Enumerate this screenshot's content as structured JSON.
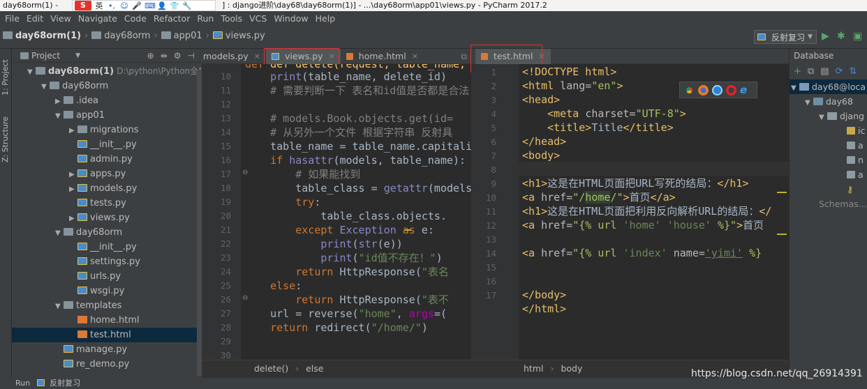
{
  "window": {
    "title_left": "day68orm(1) -",
    "title_right": "] : django进阶\\day68\\day68orm(1)] - ...\\day68orm\\app01\\views.py - PyCharm 2017.2"
  },
  "ime": {
    "logo": "S",
    "lang": "英"
  },
  "menu": [
    "File",
    "Edit",
    "View",
    "Navigate",
    "Code",
    "Refactor",
    "Run",
    "Tools",
    "VCS",
    "Window",
    "Help"
  ],
  "breadcrumb": [
    "day68orm(1)",
    "day68orm",
    "app01",
    "views.py"
  ],
  "run_config": "反射复习",
  "left_tabs": {
    "project": "1: Project",
    "structure": "Z: Structure"
  },
  "project_panel": {
    "title": "Project",
    "root": {
      "name": "day68orm(1)",
      "path": "D:\\python\\Python全栈9期"
    },
    "items": [
      {
        "label": "day68orm",
        "type": "folder",
        "depth": 1,
        "open": true
      },
      {
        "label": ".idea",
        "type": "folder",
        "depth": 2,
        "open": false
      },
      {
        "label": "app01",
        "type": "folder",
        "depth": 2,
        "open": true
      },
      {
        "label": "migrations",
        "type": "folder",
        "depth": 3,
        "open": false
      },
      {
        "label": "__init__.py",
        "type": "py",
        "depth": 3
      },
      {
        "label": "admin.py",
        "type": "py",
        "depth": 3
      },
      {
        "label": "apps.py",
        "type": "py",
        "depth": 3,
        "open": false
      },
      {
        "label": "models.py",
        "type": "py",
        "depth": 3,
        "open": false
      },
      {
        "label": "tests.py",
        "type": "py",
        "depth": 3
      },
      {
        "label": "views.py",
        "type": "py",
        "depth": 3,
        "open": false
      },
      {
        "label": "day68orm",
        "type": "folder",
        "depth": 2,
        "open": true
      },
      {
        "label": "__init__.py",
        "type": "py",
        "depth": 3
      },
      {
        "label": "settings.py",
        "type": "py",
        "depth": 3
      },
      {
        "label": "urls.py",
        "type": "py",
        "depth": 3
      },
      {
        "label": "wsgi.py",
        "type": "py",
        "depth": 3
      },
      {
        "label": "templates",
        "type": "folder",
        "depth": 2,
        "open": true
      },
      {
        "label": "home.html",
        "type": "html",
        "depth": 3
      },
      {
        "label": "test.html",
        "type": "html",
        "depth": 3,
        "selected": true
      },
      {
        "label": "manage.py",
        "type": "py",
        "depth": 2
      },
      {
        "label": "re_demo.py",
        "type": "py",
        "depth": 2
      }
    ]
  },
  "left_tabs_bar": [
    "models.py",
    "views.py",
    "home.html"
  ],
  "left_editor": {
    "line_numbers": [
      "10",
      "11",
      "12",
      "13",
      "14",
      "15",
      "16",
      "17",
      "18",
      "19",
      "20",
      "21",
      "22",
      "23",
      "24",
      "25",
      "26",
      "27",
      "28",
      "29",
      "30"
    ],
    "lines": [
      "    print(table_name, delete_id)",
      "    # 需要判断一下 表名和id值是否都是合法",
      "",
      "    # models.Book.objects.get(id=",
      "    # 从另外一个文件 根据字符串 反射具",
      "    table_name = table_name.capitalize()",
      "    if hasattr(models, table_name):",
      "        # 如果能找到",
      "        table_class = getattr(models",
      "        try:",
      "            table_class.objects.",
      "        except Exception as e:",
      "            print(str(e))",
      "            print(\"id值不存在！\")",
      "        return HttpResponse(\"表名",
      "    else:",
      "        return HttpResponse(\"表不",
      "    url = reverse(\"home\", args=(",
      "    return redirect(\"/home/\")",
      "",
      ""
    ],
    "partial_top": "def delete(request, table_name,",
    "breadcrumb": [
      "delete()",
      "else"
    ]
  },
  "right_tab": "test.html",
  "right_editor": {
    "line_numbers": [
      "1",
      "2",
      "3",
      "4",
      "5",
      "6",
      "7",
      "8",
      "9",
      "10",
      "11",
      "12",
      "13",
      "14",
      "15",
      "16",
      "17"
    ],
    "breadcrumb": [
      "html",
      "body"
    ],
    "texts": {
      "h1a": "这是在HTML页面把URL写死的结局：",
      "a1": "首页",
      "h1b": "这是在HTML页面把利用反向解析URL的结局：",
      "a2": "首页"
    }
  },
  "db_panel": {
    "title": "Database",
    "items": [
      "day68@loca",
      "day68",
      "djang",
      "ic",
      "a",
      "n",
      "a"
    ],
    "schemas": "Schemas..."
  },
  "status": {
    "run_label": "Run",
    "run_config": "反射复习"
  },
  "watermark": "https://blog.csdn.net/qq_26914391"
}
